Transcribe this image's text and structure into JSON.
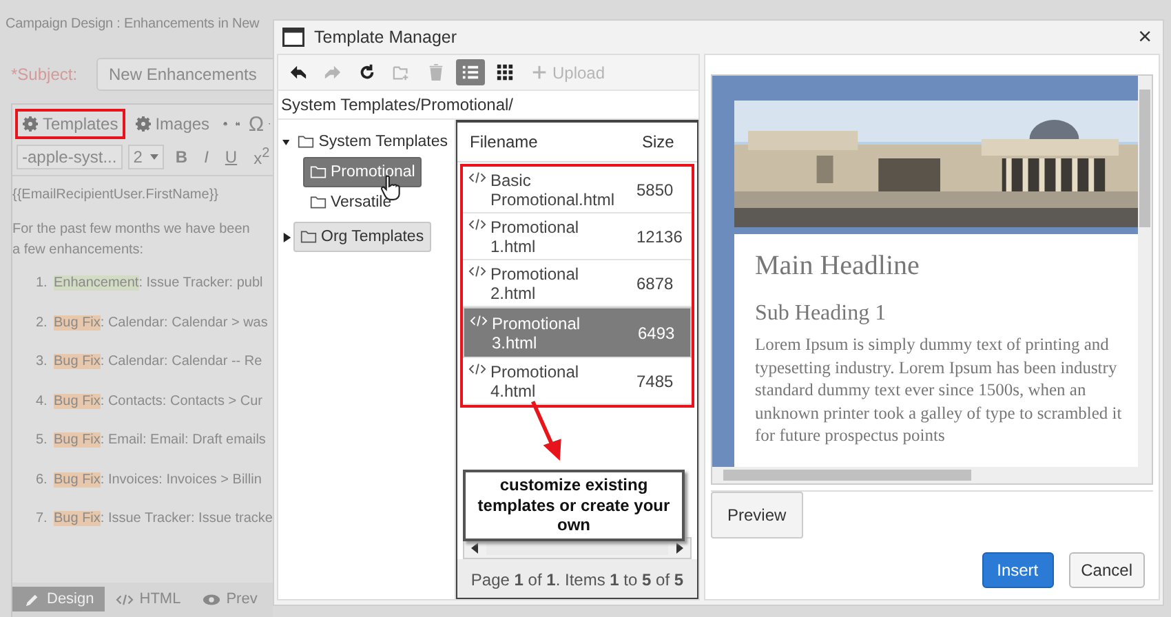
{
  "background_page": {
    "title": "Campaign Design : Enhancements in New",
    "subject_label": "*Subject:",
    "subject_value": "New Enhancements",
    "toolbar": [
      {
        "kind": "gear",
        "label": "Templates",
        "highlighted": true
      },
      {
        "kind": "gear",
        "label": "Images",
        "highlighted": false
      }
    ],
    "symbol": "Ω",
    "font": "-apple-syst...",
    "size": "2",
    "format_buttons": [
      "B",
      "I",
      "U",
      "x$^{2}$"
    ],
    "greeting": "{{EmailRecipientUser.FirstName}}",
    "intro": [
      "For the past few months we have been",
      "a few enhancements:"
    ],
    "list_items": [
      {
        "number": "1.",
        "tag": "Enhancement",
        "color": "#d2dbc4",
        "text": ": Issue Tracker: publ"
      },
      {
        "number": "2.",
        "tag": "Bug Fix",
        "color": "#e8c8ad",
        "text": ": Calendar: Calendar > was"
      },
      {
        "number": "3.",
        "tag": "Bug Fix",
        "color": "#e8c8ad",
        "text": ": Calendar: Calendar -- Re"
      },
      {
        "number": "4.",
        "tag": "Bug Fix",
        "color": "#e8c8ad",
        "text": ": Contacts: Contacts > Cur"
      },
      {
        "number": "5.",
        "tag": "Bug Fix",
        "color": "#e8c8ad",
        "text": ": Email: Email: Draft emails"
      },
      {
        "number": "6.",
        "tag": "Bug Fix",
        "color": "#e8c8ad",
        "text": ": Invoices: Invoices > Billin"
      },
      {
        "number": "7.",
        "tag": "Bug Fix",
        "color": "#e8c8ad",
        "text": ": Issue Tracker: Issue tracke"
      }
    ],
    "tabs": [
      {
        "kind": "design",
        "label": "Design",
        "selected": true
      },
      {
        "kind": "html",
        "label": "HTML",
        "selected": false
      },
      {
        "kind": "preview",
        "label": "Prev",
        "selected": false
      }
    ]
  },
  "dialog": {
    "title": "Template Manager",
    "close": "×",
    "toolbar": [
      {
        "kind": "back",
        "disabled": false,
        "selected": false
      },
      {
        "kind": "forward",
        "disabled": true,
        "selected": false
      },
      {
        "kind": "refresh",
        "disabled": false,
        "selected": false
      },
      {
        "kind": "new-folder",
        "disabled": true,
        "selected": false
      },
      {
        "kind": "delete",
        "disabled": true,
        "selected": false
      },
      {
        "kind": "list-view",
        "disabled": false,
        "selected": true
      },
      {
        "kind": "grid-view",
        "disabled": false,
        "selected": false
      },
      {
        "kind": "upload",
        "label": "Upload",
        "disabled": true,
        "selected": false
      }
    ],
    "path": "System Templates/Promotional/",
    "tree": [
      {
        "label": "System Templates",
        "expanded": true,
        "selected": false,
        "highlighted": false,
        "children": [
          {
            "label": "Promotional",
            "selected": true,
            "highlighted": false
          },
          {
            "label": "Versatile",
            "selected": false,
            "highlighted": false
          }
        ]
      },
      {
        "label": "Org Templates",
        "expanded": false,
        "selected": false,
        "highlighted": true
      }
    ],
    "files": {
      "columns": [
        "Filename",
        "Size"
      ],
      "highlighted": true,
      "rows": [
        {
          "name": "Basic Promotional.html",
          "size": "5850",
          "selected": false
        },
        {
          "name": "Promotional 1.html",
          "size": "12136",
          "selected": false
        },
        {
          "name": "Promotional 2.html",
          "size": "6878",
          "selected": false
        },
        {
          "name": "Promotional 3.html",
          "size": "6493",
          "selected": true
        },
        {
          "name": "Promotional 4.html",
          "size": "7485",
          "selected": false
        }
      ]
    },
    "callout": "customize existing templates or create your own",
    "pager": "Page **1** of **1**. Items **1** to **5** of **5**",
    "preview": {
      "headline": "Main Headline",
      "subheading": "Sub Heading 1",
      "paragraph": "Lorem Ipsum is simply dummy text of printing and typesetting industry. Lorem Ipsum has been industry standard dummy text ever since 1500s, when an unknown printer took a galley of type to scrambled it for future prospectus points"
    },
    "preview_button": "Preview",
    "actions": [
      {
        "kind": "primary",
        "label": "Insert"
      },
      {
        "kind": "secondary",
        "label": "Cancel"
      }
    ]
  }
}
